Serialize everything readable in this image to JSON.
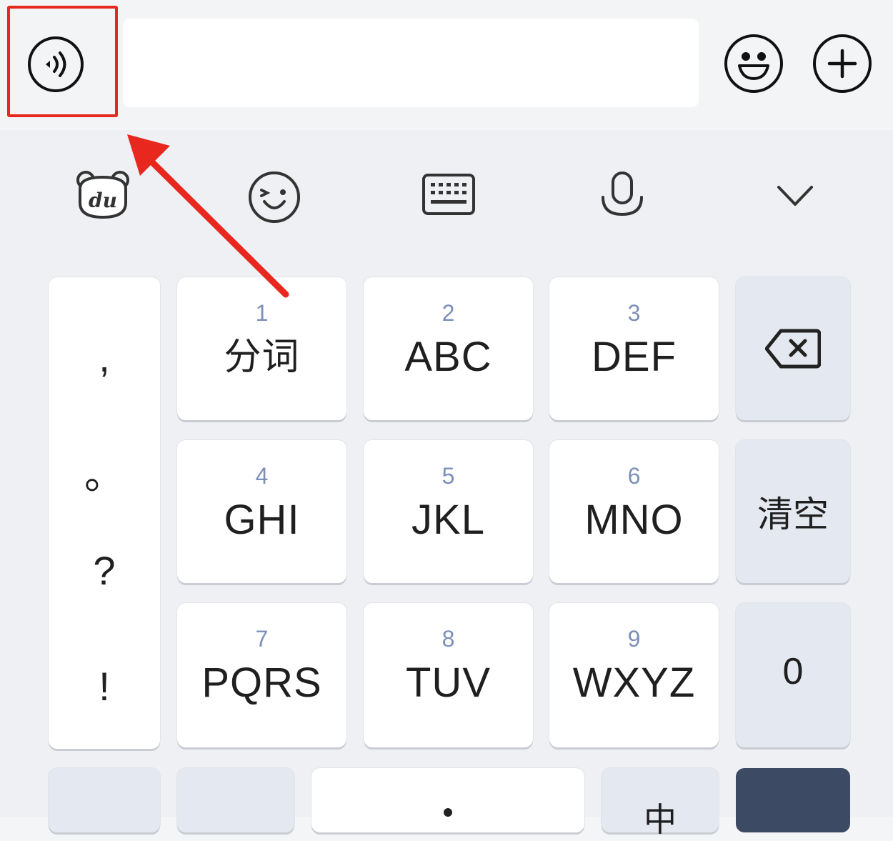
{
  "chat_bar": {
    "voice_icon": "voice-wave-icon",
    "emoji_icon": "smiley-icon",
    "plus_icon": "plus-icon"
  },
  "toolbar": {
    "icons": [
      "du-bear-logo-icon",
      "wink-face-icon",
      "keyboard-icon",
      "microphone-icon",
      "chevron-down-icon"
    ]
  },
  "punctuation": [
    ",",
    "。",
    "?",
    "!"
  ],
  "keys": [
    {
      "num": "1",
      "letters": "分词"
    },
    {
      "num": "2",
      "letters": "ABC"
    },
    {
      "num": "3",
      "letters": "DEF"
    },
    {
      "num": "4",
      "letters": "GHI"
    },
    {
      "num": "5",
      "letters": "JKL"
    },
    {
      "num": "6",
      "letters": "MNO"
    },
    {
      "num": "7",
      "letters": "PQRS"
    },
    {
      "num": "8",
      "letters": "TUV"
    },
    {
      "num": "9",
      "letters": "WXYZ"
    }
  ],
  "right_col": {
    "backspace_icon": "backspace-icon",
    "clear_label": "清空",
    "zero_label": "0"
  },
  "bottom_row": {
    "lang_label": "中"
  },
  "colors": {
    "highlight": "#e8271f",
    "accent_dark": "#3d4a63",
    "number_hint": "#7b8fb8"
  }
}
